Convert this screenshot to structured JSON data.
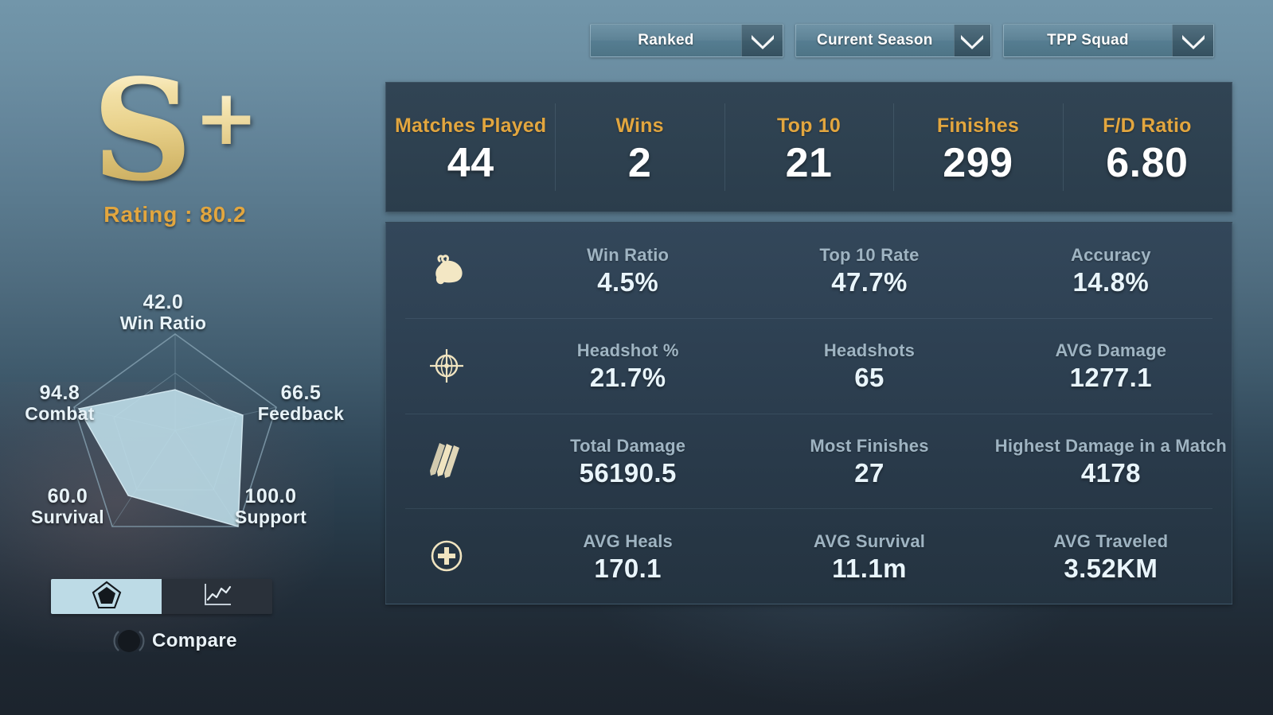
{
  "filters": [
    {
      "id": "ranked",
      "label": "Ranked",
      "icon": "chevron-down-icon"
    },
    {
      "id": "season",
      "label": "Current Season",
      "icon": "chevron-down-icon"
    },
    {
      "id": "mode",
      "label": "TPP Squad",
      "icon": "chevron-down-icon"
    }
  ],
  "rank": {
    "letter": "S",
    "plus": "+",
    "rating_text": "Rating : 80.2",
    "rating_value": 80.2
  },
  "summary": [
    {
      "label": "Matches Played",
      "value": "44"
    },
    {
      "label": "Wins",
      "value": "2"
    },
    {
      "label": "Top 10",
      "value": "21"
    },
    {
      "label": "Finishes",
      "value": "299"
    },
    {
      "label": "F/D Ratio",
      "value": "6.80"
    }
  ],
  "details": [
    {
      "icon": "chicken-dinner-icon",
      "cells": [
        {
          "label": "Win Ratio",
          "value": "4.5%"
        },
        {
          "label": "Top 10 Rate",
          "value": "47.7%"
        },
        {
          "label": "Accuracy",
          "value": "14.8%"
        }
      ]
    },
    {
      "icon": "crosshair-icon",
      "cells": [
        {
          "label": "Headshot %",
          "value": "21.7%"
        },
        {
          "label": "Headshots",
          "value": "65"
        },
        {
          "label": "AVG Damage",
          "value": "1277.1"
        }
      ]
    },
    {
      "icon": "bullets-icon",
      "cells": [
        {
          "label": "Total Damage",
          "value": "56190.5"
        },
        {
          "label": "Most Finishes",
          "value": "27"
        },
        {
          "label": "Highest Damage in a Match",
          "value": "4178"
        }
      ]
    },
    {
      "icon": "medical-plus-icon",
      "cells": [
        {
          "label": "AVG Heals",
          "value": "170.1"
        },
        {
          "label": "AVG Survival",
          "value": "11.1m"
        },
        {
          "label": "AVG Traveled",
          "value": "3.52KM"
        }
      ]
    }
  ],
  "chart_data": {
    "type": "radar",
    "title": "",
    "categories": [
      "Win Ratio",
      "Feedback",
      "Support",
      "Survival",
      "Combat"
    ],
    "values": [
      42.0,
      66.5,
      100.0,
      60.0,
      94.8
    ],
    "value_labels": [
      "42.0",
      "66.5",
      "100.0",
      "60.0",
      "94.8"
    ],
    "range": [
      0,
      100
    ],
    "grid": true,
    "legend": "none",
    "fill_color": "#bfdfea",
    "axis_color": "#7d98a8"
  },
  "controls": {
    "toggle": [
      {
        "id": "radar",
        "icon": "pentagon-radar-icon",
        "active": true
      },
      {
        "id": "line",
        "icon": "line-chart-icon",
        "active": false
      }
    ],
    "compare": {
      "label": "Compare",
      "icon": "toggle-circle-icon",
      "on": false
    }
  },
  "colors": {
    "accent_orange": "#e2a63f",
    "panel_dark": "#2e4150",
    "value_white": "#ffffff",
    "label_grey": "#9fb4c2",
    "radar_fill": "#bfdfea",
    "page_top": "#7296aa"
  }
}
